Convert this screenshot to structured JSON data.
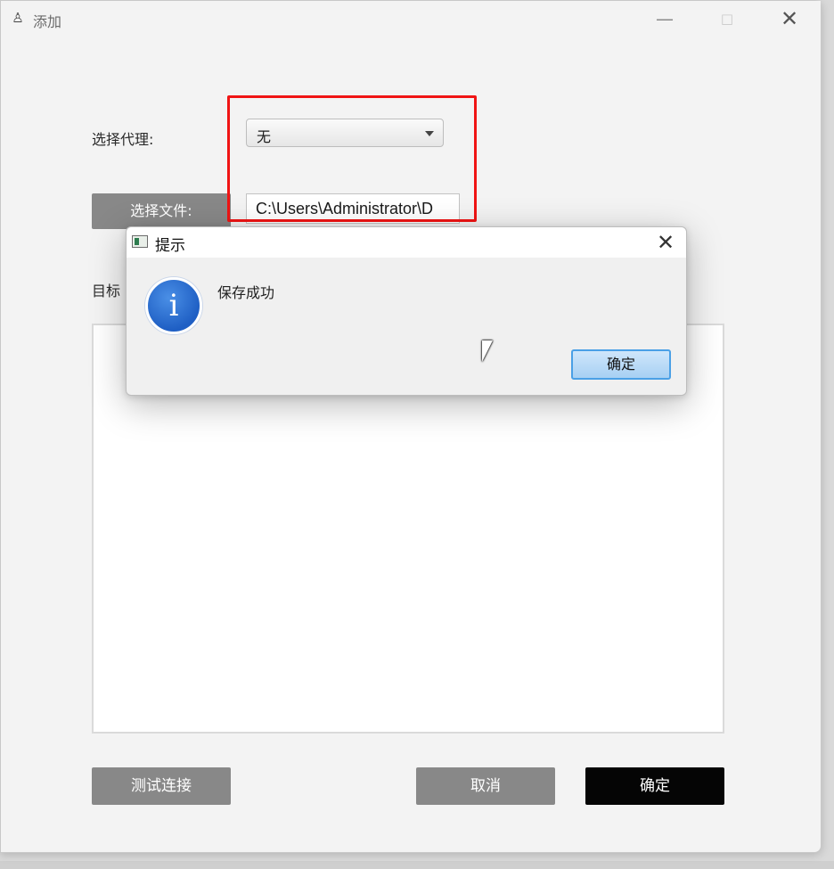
{
  "window": {
    "title": "添加",
    "app_icon": "agent-icon",
    "controls": {
      "minimize": "—",
      "maximize": "□",
      "close": "✕"
    }
  },
  "form": {
    "proxy_label": "选择代理:",
    "proxy_value": "无",
    "file_button": "选择文件:",
    "file_path": "C:\\Users\\Administrator\\D",
    "target_label": "目标"
  },
  "buttons": {
    "test_connection": "测试连接",
    "cancel": "取消",
    "confirm": "确定"
  },
  "dialog": {
    "title": "提示",
    "message": "保存成功",
    "ok_button": "确定",
    "close": "✕",
    "icon": "info-icon"
  },
  "colors": {
    "highlight": "#f01414",
    "primary_button": "#050505",
    "secondary_button": "#888888",
    "dialog_ok_border": "#4aa0e6"
  }
}
